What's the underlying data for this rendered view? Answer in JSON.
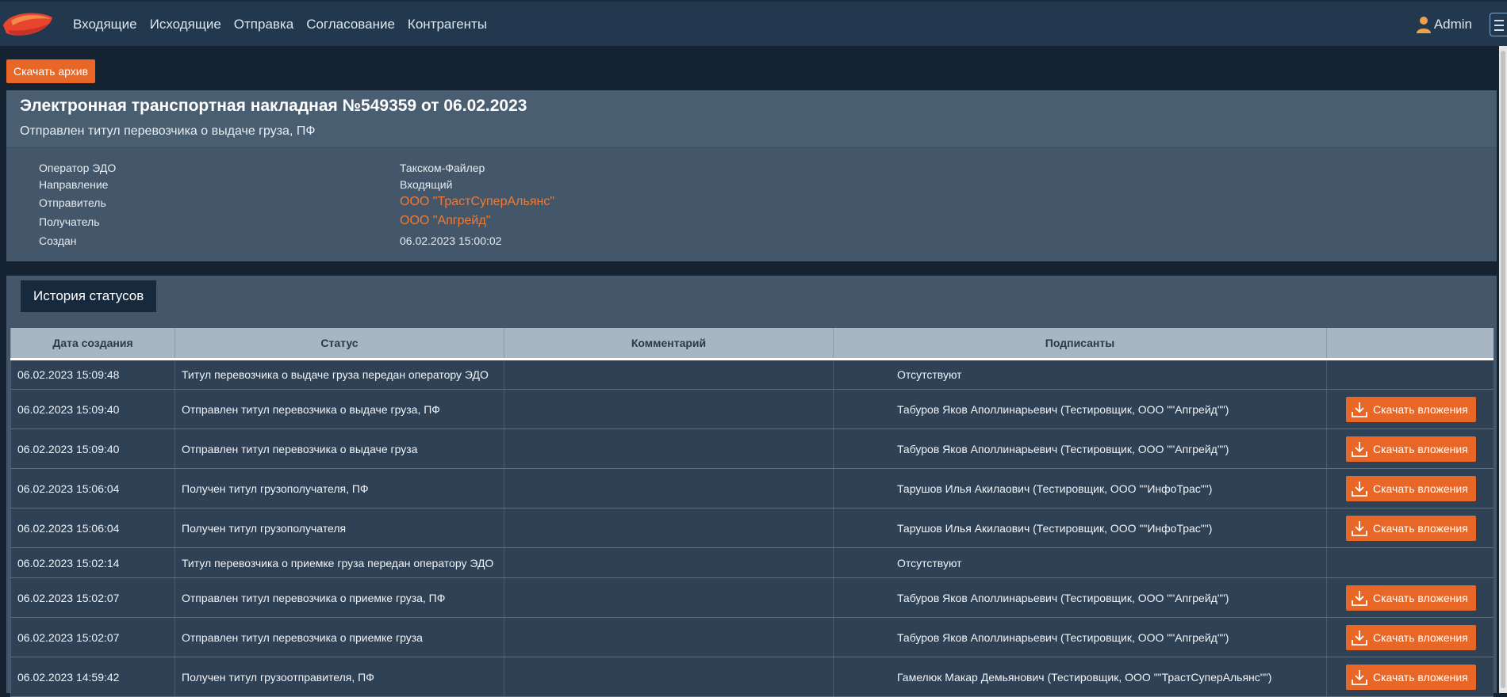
{
  "nav": {
    "items": [
      "Входящие",
      "Исходящие",
      "Отправка",
      "Согласование",
      "Контрагенты"
    ],
    "user": "Admin"
  },
  "actions": {
    "archive_label": "Скачать архив"
  },
  "document": {
    "title": "Электронная транспортная накладная №549359 от 06.02.2023",
    "status": "Отправлен титул перевозчика о выдаче груза, ПФ",
    "properties": [
      {
        "label": "Оператор ЭДО",
        "value": "Такском-Файлер"
      },
      {
        "label": "Направление",
        "value": "Входящий"
      },
      {
        "label": "Отправитель",
        "value": "ООО \"ТрастСуперАльянс\""
      },
      {
        "label": "Получатель",
        "value": "ООО \"Апгрейд\""
      },
      {
        "label": "Создан",
        "value": "06.02.2023 15:00:02"
      }
    ]
  },
  "history": {
    "tab_label": "История статусов",
    "columns": [
      "Дата создания",
      "Статус",
      "Комментарий",
      "Подписанты",
      ""
    ],
    "download_label": "Скачать вложения",
    "rows": [
      {
        "date": "06.02.2023 15:09:48",
        "status": "Титул перевозчика о выдаче груза передан оператору ЭДО",
        "comment": "",
        "signers": "Отсутствуют"
      },
      {
        "date": "06.02.2023 15:09:40",
        "status": "Отправлен титул перевозчика о выдаче груза, ПФ",
        "comment": "",
        "signers": "Табуров Яков Аполлинарьевич (Тестировщик, ООО \"\"Апгрейд\"\")"
      },
      {
        "date": "06.02.2023 15:09:40",
        "status": "Отправлен титул перевозчика о выдаче груза",
        "comment": "",
        "signers": "Табуров Яков Аполлинарьевич (Тестировщик, ООО \"\"Апгрейд\"\")"
      },
      {
        "date": "06.02.2023 15:06:04",
        "status": "Получен титул грузополучателя, ПФ",
        "comment": "",
        "signers": "Тарушов Илья Акилаович (Тестировщик, ООО \"\"ИнфоТрас\"\")"
      },
      {
        "date": "06.02.2023 15:06:04",
        "status": "Получен титул грузополучателя",
        "comment": "",
        "signers": "Тарушов Илья Акилаович (Тестировщик, ООО \"\"ИнфоТрас\"\")"
      },
      {
        "date": "06.02.2023 15:02:14",
        "status": "Титул перевозчика о приемке груза передан оператору ЭДО",
        "comment": "",
        "signers": "Отсутствуют"
      },
      {
        "date": "06.02.2023 15:02:07",
        "status": "Отправлен титул перевозчика о приемке груза, ПФ",
        "comment": "",
        "signers": "Табуров Яков Аполлинарьевич (Тестировщик, ООО \"\"Апгрейд\"\")"
      },
      {
        "date": "06.02.2023 15:02:07",
        "status": "Отправлен титул перевозчика о приемке груза",
        "comment": "",
        "signers": "Табуров Яков Аполлинарьевич (Тестировщик, ООО \"\"Апгрейд\"\")"
      },
      {
        "date": "06.02.2023 14:59:42",
        "status": "Получен титул грузоотправителя, ПФ",
        "comment": "",
        "signers": "Гамелюк Макар Демьянович (Тестировщик, ООО \"\"ТрастСуперАльянс\"\")"
      }
    ]
  },
  "colors": {
    "accent": "#e96726",
    "link": "#f07a33",
    "header_bg": "#22384f"
  }
}
